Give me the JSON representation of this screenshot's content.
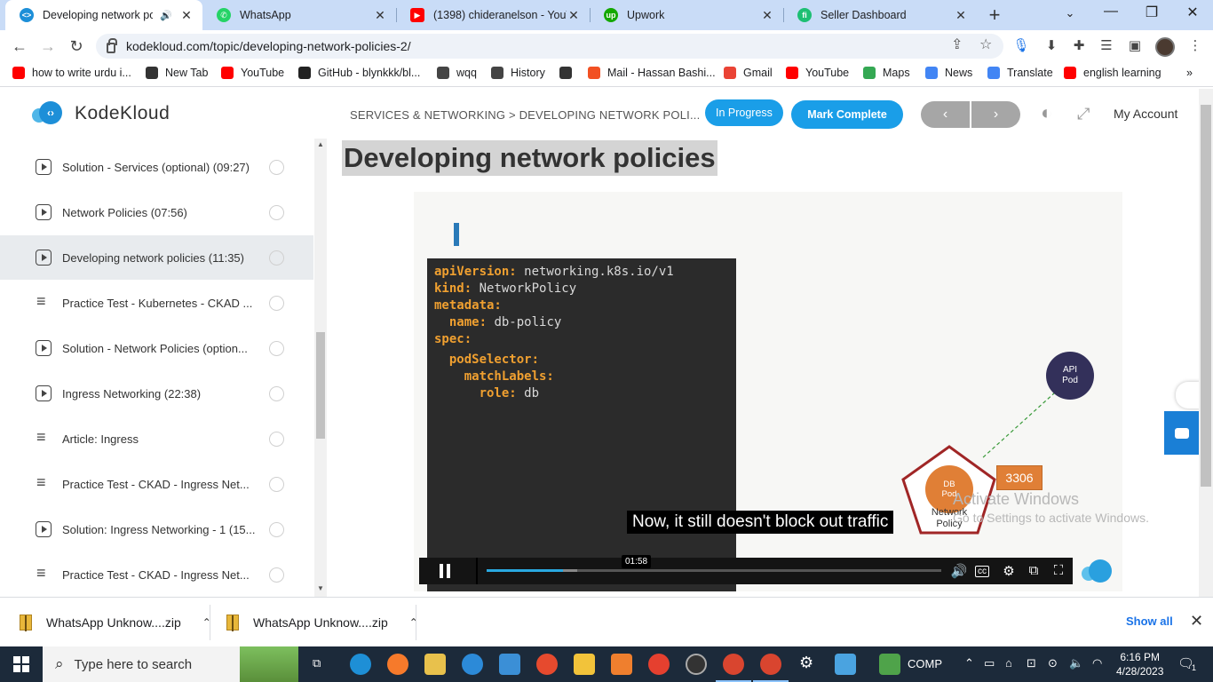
{
  "browser": {
    "tabs": [
      {
        "title": "Developing network poli",
        "active": true,
        "favicon_color": "#1d8fd8"
      },
      {
        "title": "WhatsApp",
        "active": false,
        "favicon_color": "#25d366"
      },
      {
        "title": "(1398) chideranelson - YouTu",
        "active": false,
        "favicon_color": "#ff0000"
      },
      {
        "title": "Upwork",
        "active": false,
        "favicon_color": "#14a800"
      },
      {
        "title": "Seller Dashboard",
        "active": false,
        "favicon_color": "#1dbf73"
      }
    ],
    "url": "kodekloud.com/topic/developing-network-policies-2/",
    "bookmarks": [
      {
        "label": "how to write urdu i...",
        "icon_color": "#ff0000"
      },
      {
        "label": "New Tab",
        "icon_color": "#333333"
      },
      {
        "label": "YouTube",
        "icon_color": "#ff0000"
      },
      {
        "label": "GitHub - blynkkk/bl...",
        "icon_color": "#222222"
      },
      {
        "label": "wqq",
        "icon_color": "#444444"
      },
      {
        "label": "History",
        "icon_color": "#444444"
      },
      {
        "label": "",
        "icon_color": "#333333"
      },
      {
        "label": "Mail - Hassan Bashi...",
        "icon_color": "#f25022"
      },
      {
        "label": "Gmail",
        "icon_color": "#ea4335"
      },
      {
        "label": "YouTube",
        "icon_color": "#ff0000"
      },
      {
        "label": "Maps",
        "icon_color": "#34a853"
      },
      {
        "label": "News",
        "icon_color": "#4285f4"
      },
      {
        "label": "Translate",
        "icon_color": "#4285f4"
      },
      {
        "label": "english learning",
        "icon_color": "#ff0000"
      }
    ]
  },
  "site": {
    "logo_text": "KodeKloud",
    "breadcrumb": "SERVICES & NETWORKING > DEVELOPING NETWORK POLI...",
    "status_button": "In Progress",
    "mark_complete": "Mark Complete",
    "prev": "‹",
    "next": "›",
    "account": "My Account",
    "accent": "#1a9ee8"
  },
  "sidebar": {
    "lessons": [
      {
        "title": "Solution - Services (optional) (09:27)",
        "type": "video",
        "active": false
      },
      {
        "title": "Network Policies (07:56)",
        "type": "video",
        "active": false
      },
      {
        "title": "Developing network policies (11:35)",
        "type": "video",
        "active": true
      },
      {
        "title": "Practice Test - Kubernetes - CKAD ...",
        "type": "doc",
        "active": false
      },
      {
        "title": "Solution - Network Policies (option...",
        "type": "video",
        "active": false
      },
      {
        "title": "Ingress Networking (22:38)",
        "type": "video",
        "active": false
      },
      {
        "title": "Article: Ingress",
        "type": "doc",
        "active": false
      },
      {
        "title": "Practice Test - CKAD - Ingress Net...",
        "type": "doc",
        "active": false
      },
      {
        "title": "Solution: Ingress Networking - 1 (15...",
        "type": "video",
        "active": false
      },
      {
        "title": "Practice Test - CKAD - Ingress Net...",
        "type": "doc",
        "active": false
      }
    ]
  },
  "content": {
    "title": "Developing network policies",
    "code_lines": [
      {
        "key": "apiVersion:",
        "val": " networking.k8s.io/v1",
        "indent": ""
      },
      {
        "key": "kind:",
        "val": " NetworkPolicy",
        "indent": ""
      },
      {
        "key": "metadata:",
        "val": "",
        "indent": ""
      },
      {
        "key": "name:",
        "val": " db-policy",
        "indent": "  "
      },
      {
        "key": "spec:",
        "val": "",
        "indent": ""
      },
      {
        "key": "podSelector:",
        "val": "",
        "indent": "  "
      },
      {
        "key": "matchLabels:",
        "val": "",
        "indent": "    "
      },
      {
        "key": "role:",
        "val": " db",
        "indent": "      "
      }
    ],
    "diagram": {
      "api_pod_l1": "API",
      "api_pod_l2": "Pod",
      "db_pod_l1": "DB",
      "db_pod_l2": "Pod",
      "netpol_l1": "Network",
      "netpol_l2": "Policy",
      "port": "3306"
    },
    "subtitle": "Now, it still doesn't block out traffic",
    "player": {
      "time": "01:58",
      "progress": 0.168,
      "buffered": 0.2
    }
  },
  "watermark": {
    "line1": "Activate Windows",
    "line2": "Go to Settings to activate Windows."
  },
  "downloads": {
    "items": [
      "WhatsApp Unknow....zip",
      "WhatsApp Unknow....zip"
    ],
    "show_all": "Show all"
  },
  "taskbar": {
    "search_placeholder": "Type here to search",
    "comp_label": "COMP",
    "time": "6:16 PM",
    "date": "4/28/2023",
    "notifications": "1"
  }
}
